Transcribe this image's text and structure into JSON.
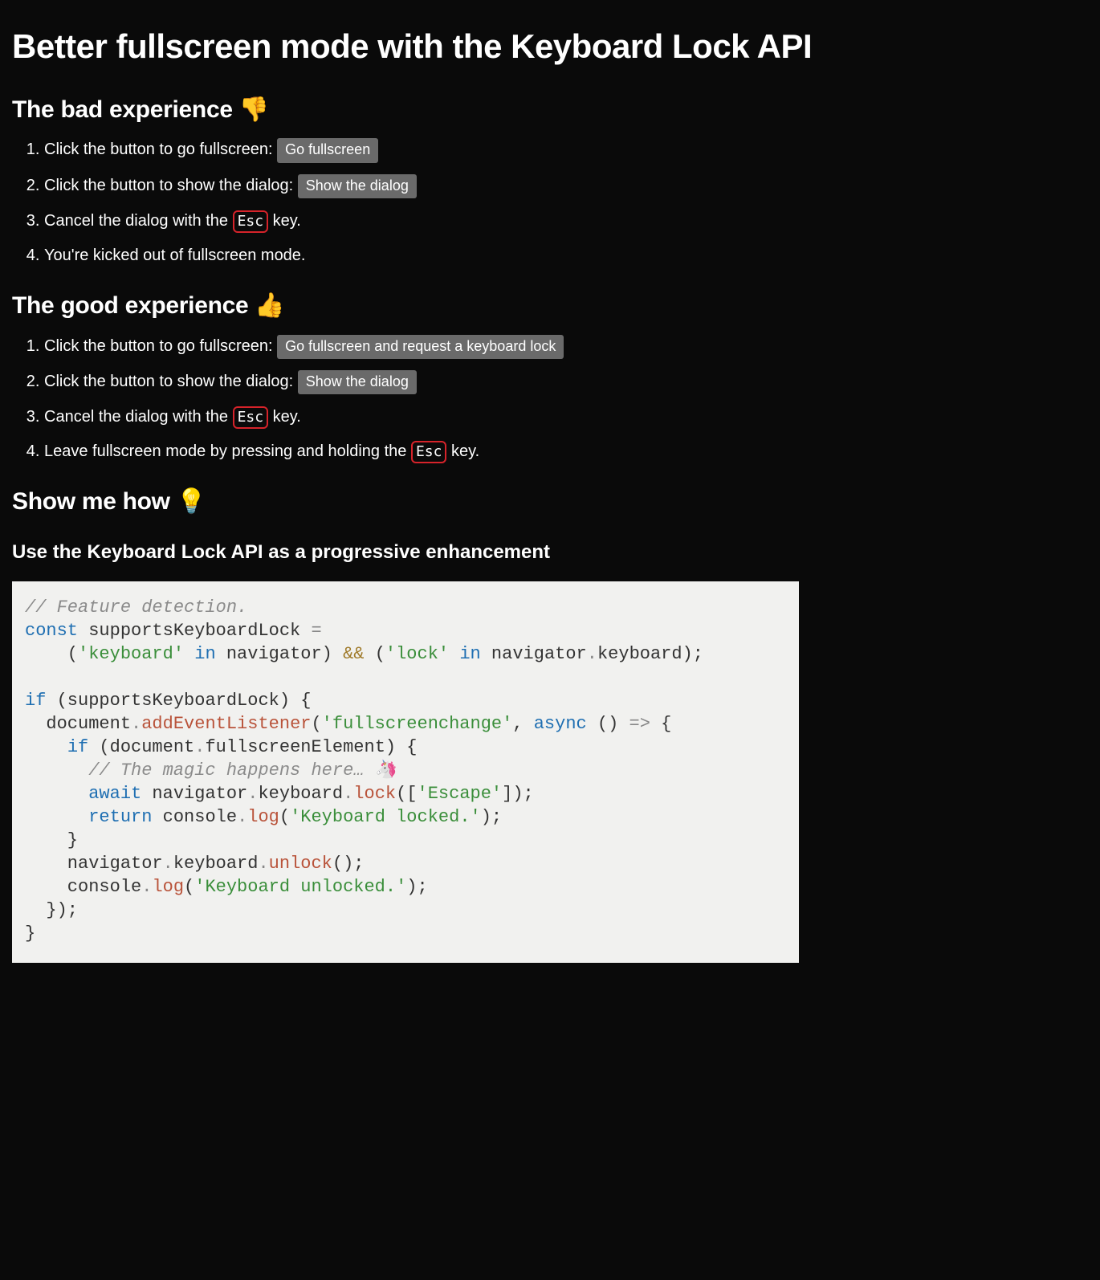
{
  "title": "Better fullscreen mode with the Keyboard Lock API",
  "bad": {
    "heading": "The bad experience 👎",
    "step1_before": "Click the button to go fullscreen: ",
    "step1_button": "Go fullscreen",
    "step2_before": "Click the button to show the dialog: ",
    "step2_button": "Show the dialog",
    "step3_before": "Cancel the dialog with the ",
    "step3_kbd": "Esc",
    "step3_after": " key.",
    "step4": "You're kicked out of fullscreen mode."
  },
  "good": {
    "heading": "The good experience 👍",
    "step1_before": "Click the button to go fullscreen: ",
    "step1_button": "Go fullscreen and request a keyboard lock",
    "step2_before": "Click the button to show the dialog: ",
    "step2_button": "Show the dialog",
    "step3_before": "Cancel the dialog with the ",
    "step3_kbd": "Esc",
    "step3_after": " key.",
    "step4_before": "Leave fullscreen mode by pressing and holding the ",
    "step4_kbd": "Esc",
    "step4_after": " key."
  },
  "how": {
    "heading": "Show me how 💡",
    "sub": "Use the Keyboard Lock API as a progressive enhancement"
  },
  "code": {
    "c1": "// Feature detection.",
    "kw_const": "const",
    "id_supports": " supportsKeyboardLock ",
    "op_eq": "=",
    "l2_a": "    (",
    "s_keyboard": "'keyboard'",
    "kw_in1": " in",
    "l2_b": " navigator) ",
    "op_and": "&&",
    "l2_c": " (",
    "s_lock": "'lock'",
    "kw_in2": " in",
    "l2_d": " navigator",
    "dot1": ".",
    "l2_e": "keyboard);",
    "kw_if1": "if",
    "l4_a": " (supportsKeyboardLock) {",
    "l5_a": "  document",
    "dot2": ".",
    "fn_add": "addEventListener",
    "l5_b": "(",
    "s_fsc": "'fullscreenchange'",
    "l5_c": ", ",
    "kw_async": "async",
    "l5_d": " () ",
    "op_arrow": "=>",
    "l5_e": " {",
    "l6_a": "    ",
    "kw_if2": "if",
    "l6_b": " (document",
    "dot3": ".",
    "l6_c": "fullscreenElement) {",
    "c2": "      // The magic happens here… 🦄",
    "l8_a": "      ",
    "kw_await": "await",
    "l8_b": " navigator",
    "dot4": ".",
    "l8_c": "keyboard",
    "dot5": ".",
    "fn_lock": "lock",
    "l8_d": "([",
    "s_escape": "'Escape'",
    "l8_e": "]);",
    "l9_a": "      ",
    "kw_return": "return",
    "l9_b": " console",
    "dot6": ".",
    "fn_log1": "log",
    "l9_c": "(",
    "s_locked": "'Keyboard locked.'",
    "l9_d": ");",
    "l10": "    }",
    "l11_a": "    navigator",
    "dot7": ".",
    "l11_b": "keyboard",
    "dot8": ".",
    "fn_unlock": "unlock",
    "l11_c": "();",
    "l12_a": "    console",
    "dot9": ".",
    "fn_log2": "log",
    "l12_b": "(",
    "s_unlocked": "'Keyboard unlocked.'",
    "l12_c": ");",
    "l13": "  });",
    "l14": "}"
  }
}
